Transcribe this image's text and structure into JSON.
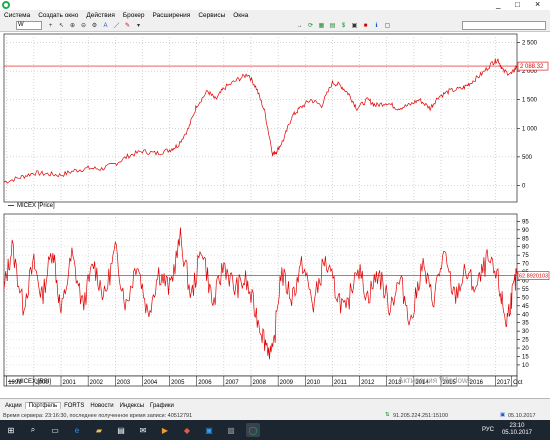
{
  "menu": [
    "Система",
    "Создать окно",
    "Действия",
    "Брокер",
    "Расширения",
    "Сервисы",
    "Окна"
  ],
  "toolbar": {
    "symbol": "W",
    "search_placeholder": ""
  },
  "window_controls": {
    "minimize": "_",
    "restore": "□",
    "close": "×"
  },
  "price_pane": {
    "caption": "MICEX [Price]",
    "price_label": "2 088.32",
    "axis_ticks": [
      "2 500",
      "2 000",
      "1 500",
      "1 000",
      "500",
      "0"
    ],
    "axis_values": [
      2500,
      2000,
      1500,
      1000,
      500,
      0
    ]
  },
  "rsi_pane": {
    "caption": "MICEX [RSI]",
    "value_label": "62.8920103",
    "axis_ticks": [
      "95",
      "90",
      "85",
      "80",
      "75",
      "70",
      "65",
      "60",
      "55",
      "50",
      "45",
      "40",
      "35",
      "30",
      "25",
      "20",
      "15",
      "10"
    ],
    "axis_values": [
      95,
      90,
      85,
      80,
      75,
      70,
      65,
      60,
      55,
      50,
      45,
      40,
      35,
      30,
      25,
      20,
      15,
      10
    ]
  },
  "years": [
    "1999",
    "2000",
    "2001",
    "2002",
    "2003",
    "2004",
    "2005",
    "2006",
    "2007",
    "2008",
    "2009",
    "2010",
    "2011",
    "2012",
    "2013",
    "2014",
    "2015",
    "2016",
    "2017",
    "Oct"
  ],
  "tabs": [
    "Акции",
    "Портфель",
    "FORTS",
    "Новости",
    "Индексы",
    "Графики"
  ],
  "status": {
    "left": "Время сервера: 23:16:30, последнее полученное время записи: 40512791",
    "ip": "91.205.224.251:15100",
    "date": "05.10.2017"
  },
  "watermark": "Активация Windows",
  "taskbar": {
    "lang": "РУС",
    "time": "23:10",
    "date": "05.10.2017"
  },
  "chart_data": [
    {
      "type": "line",
      "title": "MICEX [Price]",
      "x": [
        1998.9,
        1999.5,
        2000,
        2000.5,
        2001,
        2001.5,
        2002,
        2002.5,
        2003,
        2003.5,
        2004,
        2004.5,
        2005,
        2005.3,
        2005.7,
        2006,
        2006.4,
        2006.7,
        2007,
        2007.5,
        2007.9,
        2008.2,
        2008.5,
        2008.8,
        2008.95,
        2009.2,
        2009.5,
        2009.8,
        2010.2,
        2010.6,
        2011,
        2011.3,
        2011.6,
        2011.9,
        2012.3,
        2012.6,
        2013,
        2013.4,
        2013.8,
        2014.2,
        2014.6,
        2014.9,
        2015.3,
        2015.8,
        2016.1,
        2016.5,
        2016.9,
        2017.1,
        2017.3,
        2017.6,
        2017.8
      ],
      "values": [
        60,
        140,
        220,
        200,
        180,
        260,
        300,
        290,
        380,
        520,
        600,
        560,
        620,
        700,
        1000,
        1400,
        1650,
        1500,
        1700,
        1850,
        1950,
        1700,
        1300,
        550,
        600,
        800,
        1200,
        1350,
        1500,
        1400,
        1800,
        1750,
        1600,
        1350,
        1500,
        1400,
        1450,
        1350,
        1400,
        1500,
        1350,
        1550,
        1650,
        1700,
        1800,
        1950,
        2150,
        2200,
        2000,
        1950,
        2090
      ],
      "ylim": [
        0,
        2500
      ],
      "reference_line": 2088.32
    },
    {
      "type": "line",
      "title": "MICEX [RSI]",
      "x": [
        1998.9,
        1999.2,
        1999.6,
        2000,
        2000.3,
        2000.7,
        2001,
        2001.4,
        2001.8,
        2002.2,
        2002.6,
        2003,
        2003.4,
        2003.8,
        2004.2,
        2004.6,
        2005,
        2005.4,
        2005.8,
        2006.2,
        2006.6,
        2007,
        2007.4,
        2007.8,
        2008.2,
        2008.5,
        2008.8,
        2009.1,
        2009.5,
        2009.9,
        2010.3,
        2010.7,
        2011.1,
        2011.5,
        2011.9,
        2012.3,
        2012.7,
        2013.1,
        2013.5,
        2013.9,
        2014.3,
        2014.7,
        2015.1,
        2015.5,
        2015.9,
        2016.3,
        2016.7,
        2017.1,
        2017.4,
        2017.6,
        2017.8
      ],
      "values": [
        55,
        80,
        45,
        70,
        50,
        80,
        40,
        75,
        45,
        70,
        50,
        78,
        45,
        72,
        40,
        65,
        55,
        85,
        50,
        80,
        45,
        70,
        55,
        60,
        40,
        25,
        15,
        65,
        50,
        70,
        45,
        72,
        55,
        40,
        70,
        50,
        65,
        45,
        60,
        35,
        70,
        48,
        75,
        50,
        65,
        55,
        72,
        60,
        35,
        50,
        63
      ],
      "ylim": [
        10,
        95
      ],
      "reference_line": 62.89
    }
  ]
}
